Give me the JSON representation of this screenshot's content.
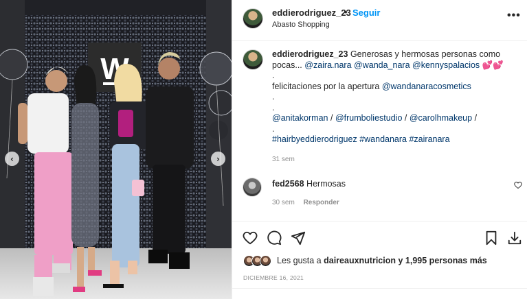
{
  "post": {
    "username": "eddierodriguez_23",
    "dot": "•",
    "follow_label": "Seguir",
    "location": "Abasto Shopping",
    "more_label": "•••"
  },
  "caption": {
    "username": "eddierodriguez_23",
    "text_1": "Generosas y hermosas personas como pocas...",
    "mention_zaira": "@zaira.nara",
    "mention_wanda": "@wanda_nara",
    "mention_kenny": "@kennyspalacios",
    "emoji": "💕💕",
    "dot": ".",
    "felicitaciones": "felicitaciones por la apertura",
    "mention_cosmetics": "@wandanaracosmetics",
    "mention_anita": "@anitakorman",
    "mention_frum": "@frumboliestudio",
    "mention_carol": "@carolhmakeup",
    "slash": "/",
    "hashtag_1": "#hairbyeddierodriguez",
    "hashtag_2": "#wandanara",
    "hashtag_3": "#zairanara",
    "time": "31 sem"
  },
  "comment": {
    "username": "fed2568",
    "text": "Hermosas",
    "time": "30 sem",
    "reply_label": "Responder"
  },
  "likes": {
    "prefix": "Les gusta a",
    "user": "daireauxnutricion",
    "suffix": "y 1,995 personas más"
  },
  "date": "DICIEMBRE 16, 2021",
  "icons": {
    "prev": "‹",
    "next": "›",
    "like": "heart-icon",
    "comment": "comment-icon",
    "share": "send-icon",
    "save": "bookmark-icon",
    "download": "download-icon"
  },
  "colors": {
    "link": "#0095f6",
    "mention": "#00376b",
    "muted": "#8e8e8e",
    "text": "#262626"
  },
  "media": {
    "logo_letter": "W"
  }
}
